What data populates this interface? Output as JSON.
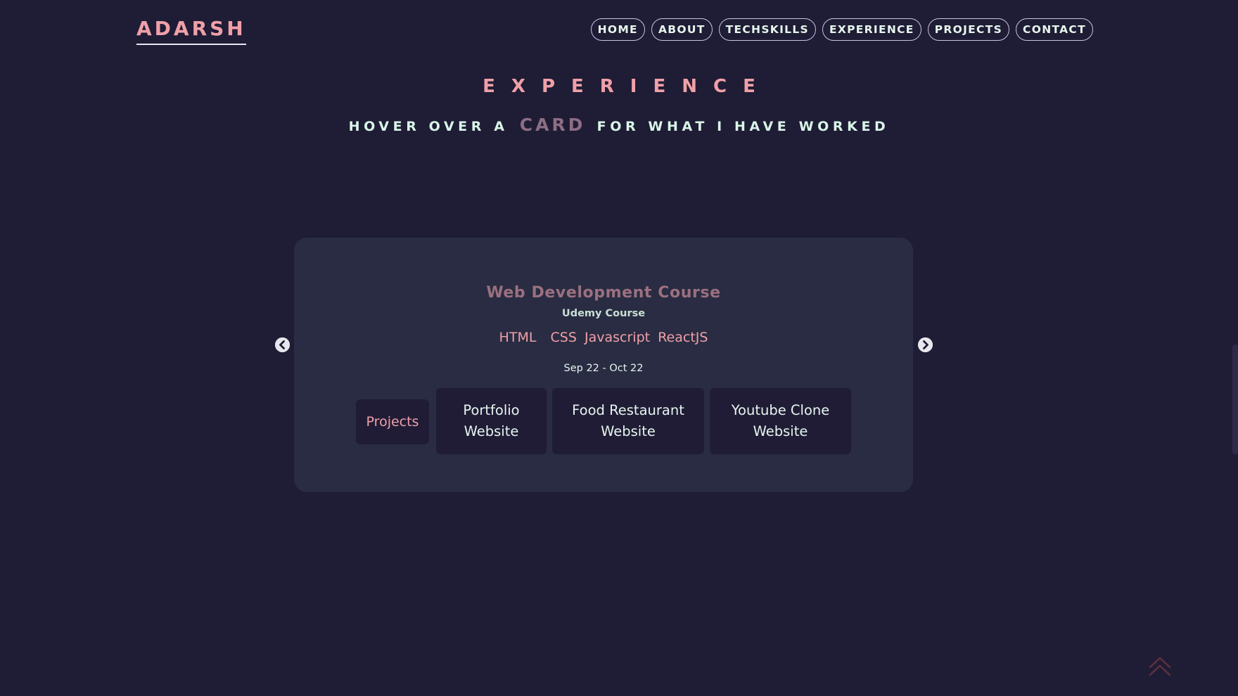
{
  "header": {
    "logo": "ADARSH",
    "nav": [
      "HOME",
      "ABOUT",
      "TECHSKILLS",
      "EXPERIENCE",
      "PROJECTS",
      "CONTACT"
    ]
  },
  "section": {
    "title": "EXPERIENCE",
    "subtitle_before": "HOVER OVER A",
    "subtitle_emphasis": "CARD",
    "subtitle_after": "FOR WHAT I HAVE WORKED"
  },
  "card": {
    "title": "Web Development Course",
    "organization": "Udemy Course",
    "technologies": [
      "HTML",
      "CSS",
      "Javascript",
      "ReactJS"
    ],
    "date": "Sep 22 - Oct 22",
    "projects_label": "Projects",
    "projects": [
      {
        "line1": "Portfolio",
        "line2": "Website"
      },
      {
        "line1": "Food Restaurant",
        "line2": "Website"
      },
      {
        "line1": "Youtube Clone",
        "line2": "Website"
      }
    ]
  },
  "icons": {
    "prev": "chevron-left-circle-icon",
    "next": "chevron-right-circle-icon",
    "back_to_top": "double-chevron-up-icon"
  },
  "colors": {
    "background": "#1f1c35",
    "card": "#292c42",
    "accent_pink": "#f0a0a8",
    "mint_text": "#e6f6ee",
    "muted_mauve": "#8c6e84"
  }
}
